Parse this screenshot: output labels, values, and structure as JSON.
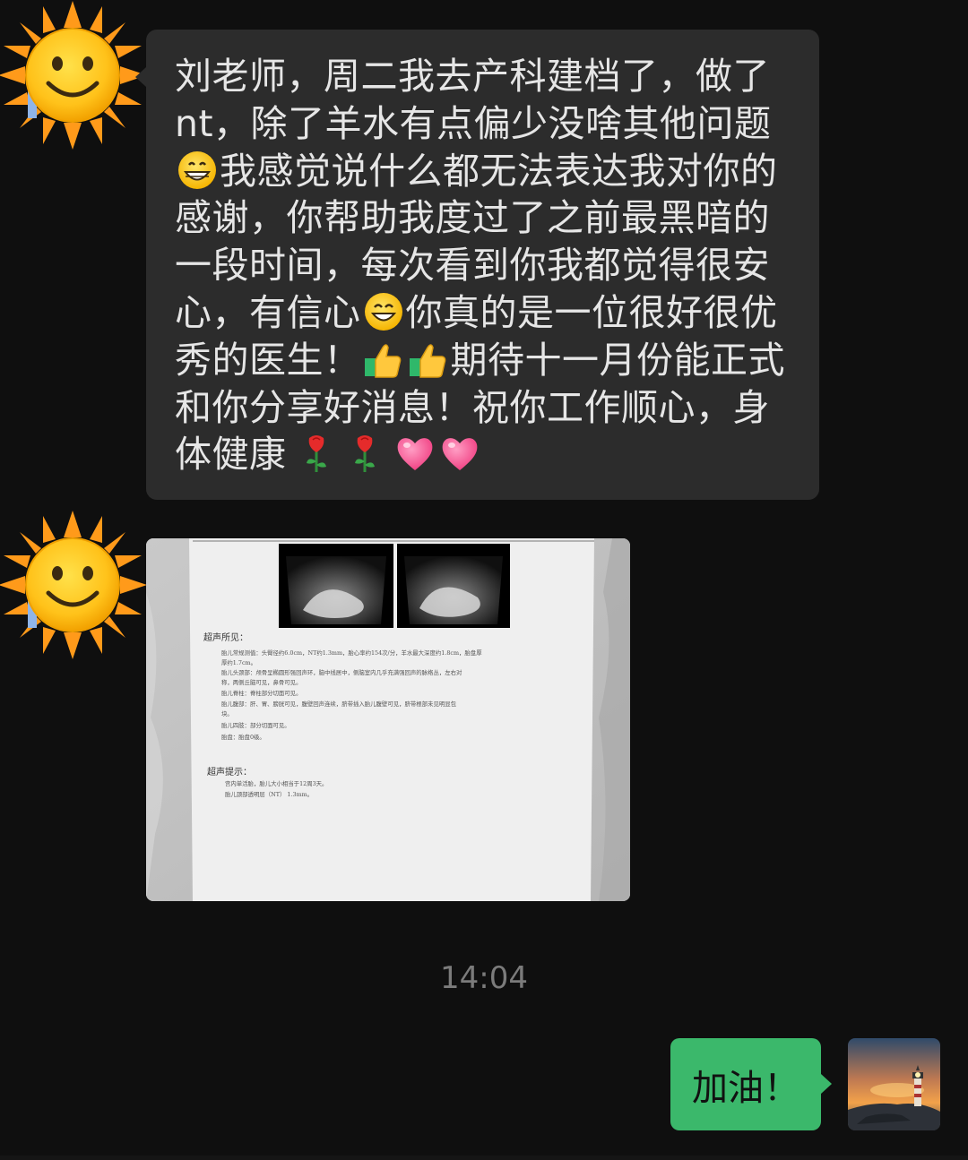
{
  "messages": {
    "incoming_text": {
      "seg1": "刘老师，周二我去产科建档了，做了nt，除了羊水有点偏少没啥其他问题",
      "seg2": "我感觉说什么都无法表达我对你的感谢，你帮助我度过了之前最黑暗的一段时间，每次看到你我都觉得很安心，有信心",
      "seg3": "你真的是一位很好很优秀的医生！",
      "seg4": "期待十一月份能正式和你分享好消息！祝你工作顺心，身体健康"
    },
    "incoming_image": {
      "findings_title": "超声所见：",
      "findings": [
        "胎儿常规测值：头臀径约6.0cm，NT约1.3mm，胎心率约154次/分，羊水最大深度约1.8cm，胎盘厚",
        "厚约1.7cm。",
        "胎儿头颈部：颅骨呈椭圆形强回声环，脑中线居中，侧脑室内几乎充满强回声的脉络丛，左右对",
        "称，两侧丘脑可见，鼻骨可见。",
        "胎儿脊柱：脊柱部分切面可见。",
        "胎儿腹部：肝、胃、膀胱可见，腹壁回声连续，脐带插入胎儿腹壁可见，脐带根部未见明显包",
        "块。",
        "胎儿四肢：部分切面可见。",
        "胎盘：胎盘0级。"
      ],
      "hints_title": "超声提示：",
      "hints": [
        "宫内单活胎，胎儿大小相当于12周3天。",
        "胎儿颈部透明层（NT）    1.3mm。"
      ]
    },
    "timestamp": "14:04",
    "outgoing_text": "加油！"
  },
  "icons": {
    "sender_avatar": "sun-smiley-avatar",
    "emoji_1": "grinning-face-icon",
    "emoji_2": "smiling-face-icon",
    "emoji_3": "thumbs-up-icon",
    "emoji_4": "rose-icon",
    "emoji_5": "heart-icon",
    "self_avatar": "lighthouse-sunset-avatar"
  },
  "colors": {
    "background": "#0f0f0f",
    "incoming_bubble": "#2c2c2c",
    "outgoing_bubble": "#3bb86b",
    "timestamp": "#7b7b7b"
  }
}
